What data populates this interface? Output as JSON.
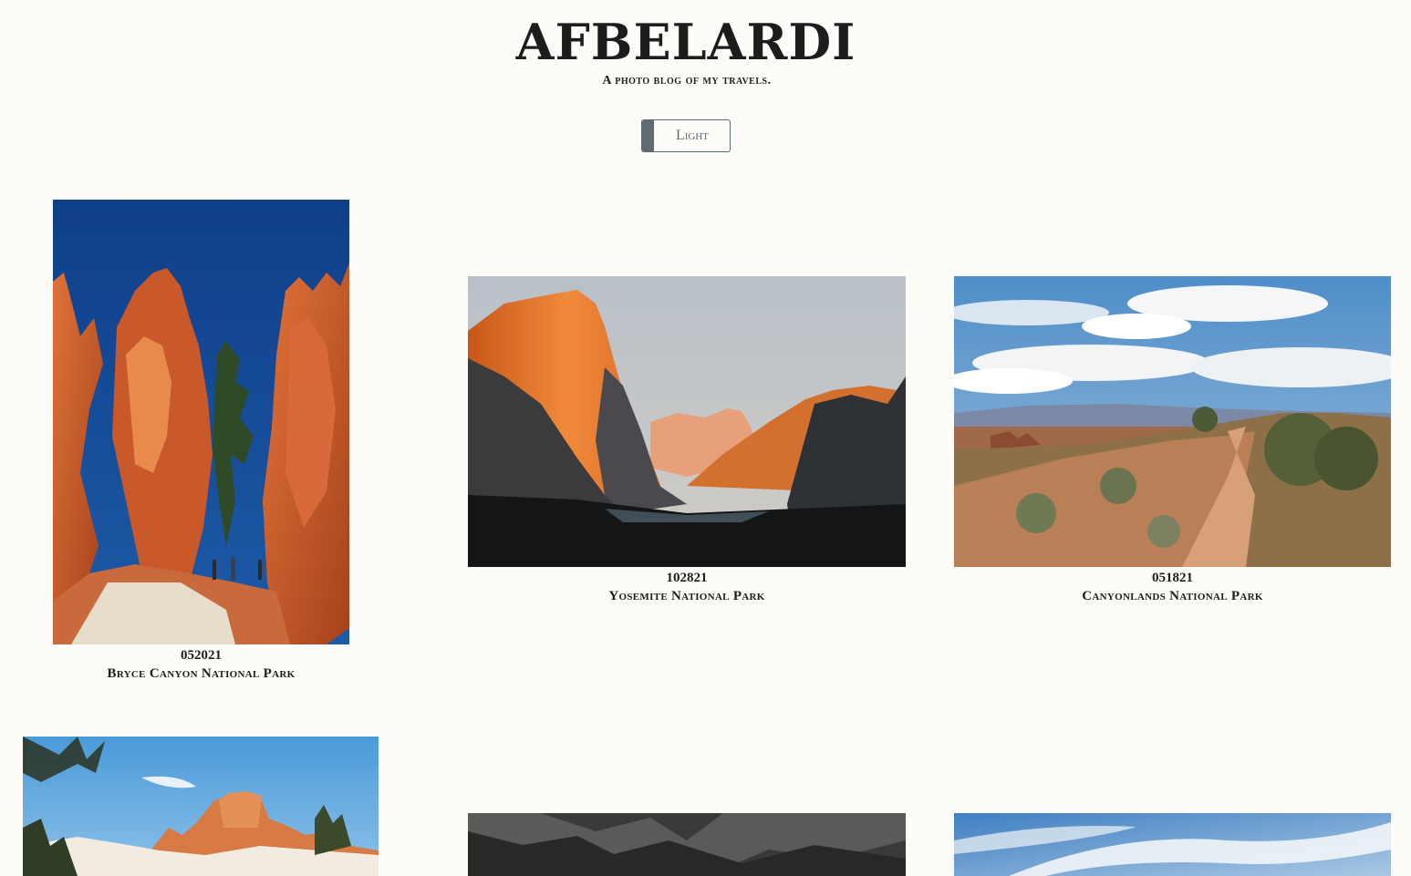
{
  "header": {
    "title": "AFBELARDI",
    "subtitle": "A photo blog of my travels."
  },
  "theme_toggle": {
    "label": "Light"
  },
  "posts": [
    {
      "date": "052021",
      "location": "Bryce Canyon National Park"
    },
    {
      "date": "102821",
      "location": "Yosemite National Park"
    },
    {
      "date": "051821",
      "location": "Canyonlands National Park"
    }
  ]
}
